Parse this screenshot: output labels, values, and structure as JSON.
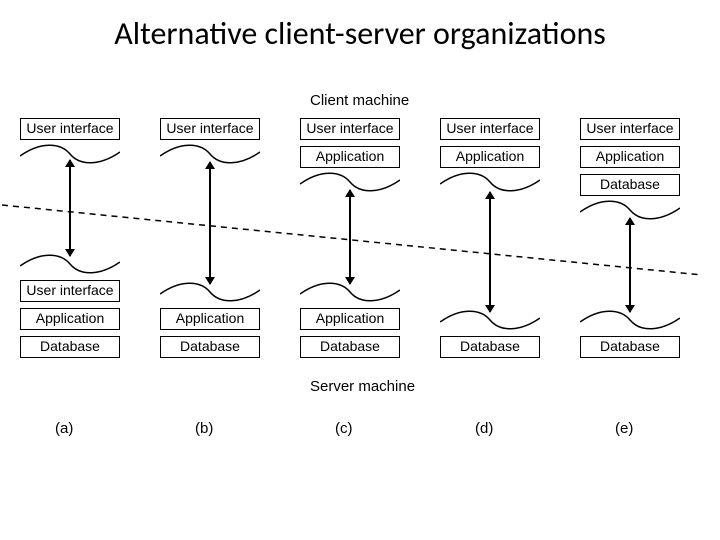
{
  "title": "Alternative client-server organizations",
  "labels": {
    "client": "Client machine",
    "server": "Server machine",
    "ui": "User interface",
    "app": "Application",
    "db": "Database"
  },
  "columns": [
    "(a)",
    "(b)",
    "(c)",
    "(d)",
    "(e)"
  ]
}
